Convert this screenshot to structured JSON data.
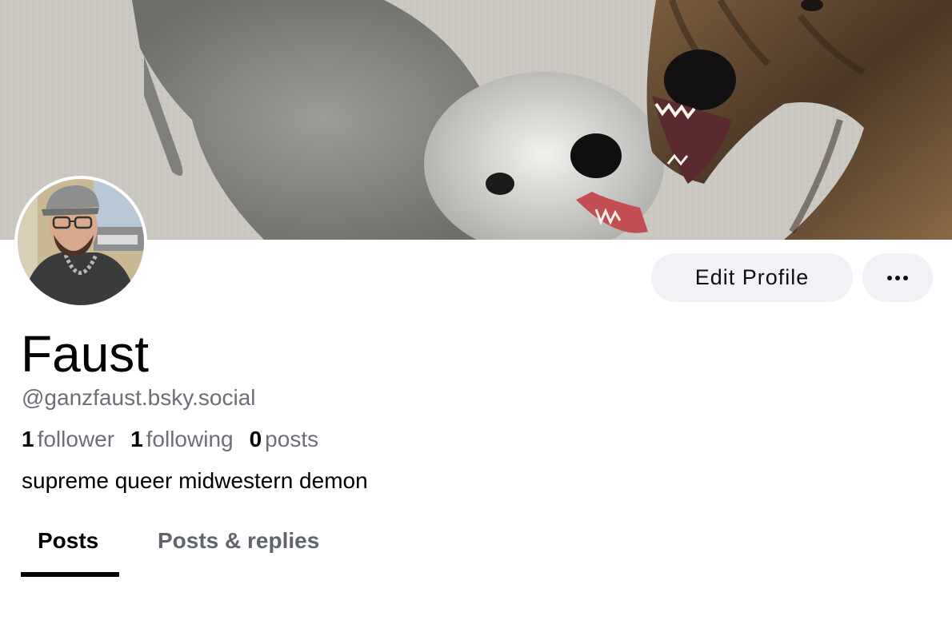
{
  "banner": {
    "alt_subject": "dog-photo"
  },
  "avatar": {
    "subject": "profile-photo"
  },
  "actions": {
    "edit_profile_label": "Edit Profile",
    "more_icon": "ellipsis-icon"
  },
  "profile": {
    "display_name": "Faust",
    "handle": "@ganzfaust.bsky.social",
    "bio": "supreme queer midwestern demon"
  },
  "stats": {
    "followers_count": "1",
    "followers_label": "follower",
    "following_count": "1",
    "following_label": "following",
    "posts_count": "0",
    "posts_label": "posts"
  },
  "tabs": [
    {
      "label": "Posts",
      "active": true
    },
    {
      "label": "Posts & replies",
      "active": false
    }
  ]
}
